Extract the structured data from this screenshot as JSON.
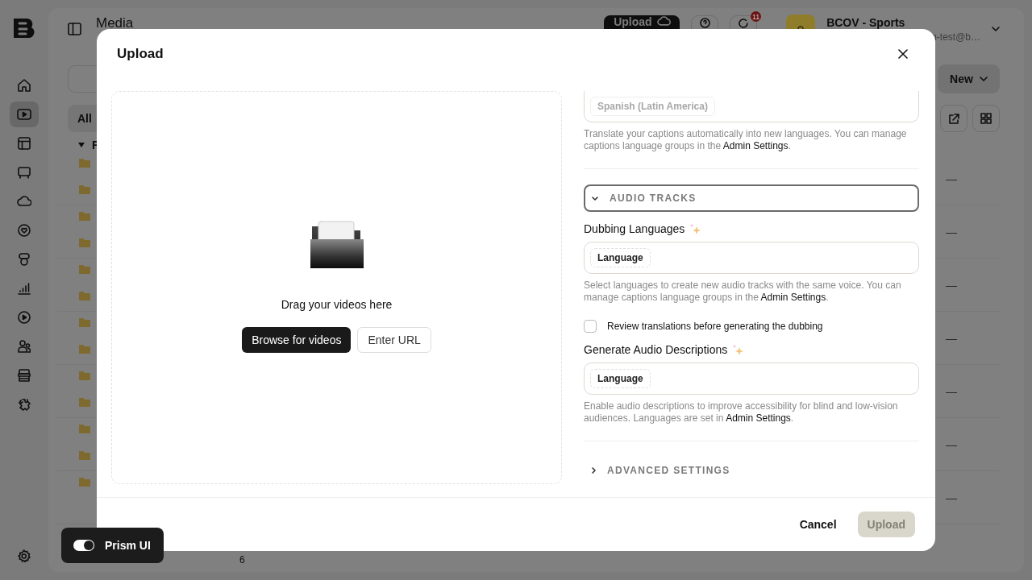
{
  "sidebar": {
    "items": [
      {
        "selected": false
      },
      {
        "selected": true
      },
      {
        "selected": false
      },
      {
        "selected": false
      },
      {
        "selected": false
      },
      {
        "selected": false
      },
      {
        "selected": false
      },
      {
        "selected": false
      },
      {
        "selected": false
      },
      {
        "selected": false
      },
      {
        "selected": false
      },
      {
        "selected": false
      }
    ]
  },
  "header": {
    "title": "Media",
    "upload_button": "Upload",
    "notification_count": "11",
    "account": {
      "name": "BCOV - Sports",
      "email": "n-test@b…"
    }
  },
  "toolbar": {
    "new_button": "New",
    "filter_tab": "All"
  },
  "tree": {
    "root": "F",
    "expanded": true
  },
  "table": {
    "rows": [
      {
        "cell": "—"
      },
      {
        "cell": "—"
      },
      {
        "cell": "—"
      },
      {
        "cell": "—"
      },
      {
        "cell": "—"
      },
      {
        "cell": "—"
      },
      {
        "cell": "—"
      }
    ]
  },
  "footer_count": "6",
  "prism_toggle": {
    "label": "Prism UI",
    "on": true
  },
  "modal": {
    "title": "Upload",
    "dropzone": {
      "prompt": "Drag your videos here",
      "browse_button": "Browse for videos",
      "url_button": "Enter URL"
    },
    "items": [
      {
        "kind": "field",
        "chips": [
          {
            "text": "Spanish (Latin America)",
            "placeholder": false
          }
        ]
      },
      {
        "kind": "help",
        "text": "Translate your captions automatically into new languages. You can manage captions language groups in the ",
        "link": "Admin Settings",
        "end": "."
      },
      {
        "kind": "divider"
      },
      {
        "kind": "section",
        "label": "AUDIO TRACKS",
        "expanded": true,
        "focused": true
      },
      {
        "kind": "label",
        "text": "Dubbing Languages",
        "ai": true
      },
      {
        "kind": "field",
        "chips": [
          {
            "text": "Language",
            "placeholder": true
          }
        ]
      },
      {
        "kind": "help",
        "text": "Select languages to create new audio tracks with the same voice. You can manage captions language groups in the ",
        "link": "Admin Settings",
        "end": "."
      },
      {
        "kind": "checkbox",
        "label": "Review translations before generating the dubbing",
        "checked": false
      },
      {
        "kind": "label",
        "text": "Generate Audio Descriptions",
        "ai": true
      },
      {
        "kind": "field",
        "chips": [
          {
            "text": "Language",
            "placeholder": true
          }
        ]
      },
      {
        "kind": "help",
        "text": "Enable audio descriptions to improve accessibility for blind and low-vision audiences. Languages are set in ",
        "link": "Admin Settings",
        "end": "."
      },
      {
        "kind": "divider"
      },
      {
        "kind": "section",
        "label": "ADVANCED SETTINGS",
        "expanded": false,
        "focused": false
      }
    ],
    "cancel_button": "Cancel",
    "upload_button": {
      "label": "Upload",
      "disabled": true
    }
  }
}
